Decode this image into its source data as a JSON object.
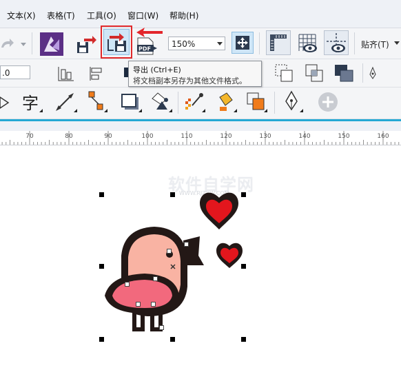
{
  "menu": {
    "items": [
      "文本(X)",
      "表格(T)",
      "工具(O)",
      "窗口(W)",
      "帮助(H)"
    ]
  },
  "toolbar": {
    "zoom_value": "150%",
    "snap_label": "贴齐(T)"
  },
  "property_bar": {
    "value_field": ".0"
  },
  "tooltip": {
    "title": "导出 (Ctrl+E)",
    "description": "将文档副本另存为其他文件格式。"
  },
  "ruler": {
    "labels": [
      "70",
      "80",
      "90",
      "100",
      "110",
      "120",
      "130",
      "140",
      "150",
      "160"
    ]
  },
  "canvas": {
    "watermark": "软件自学网",
    "watermark_sub": "WWW.RJZXW.COM"
  },
  "icons": {
    "export": "export-icon",
    "import": "import-icon",
    "publish_pdf": "pdf-icon",
    "redo": "redo-icon",
    "corel_launcher": "corel-launcher-icon",
    "full_screen_preview": "full-screen-icon",
    "rulers": "ruler-icon",
    "grid": "grid-icon",
    "guidelines": "guideline-icon",
    "text_tool": "text-tool-icon",
    "add": "add-icon"
  },
  "colors": {
    "highlight_border": "#e0282a",
    "arrow_red": "#e3262b",
    "bird_body": "#f9b3a3",
    "bird_wing": "#f2697d",
    "heart_red": "#e3161d",
    "outline": "#231816"
  }
}
